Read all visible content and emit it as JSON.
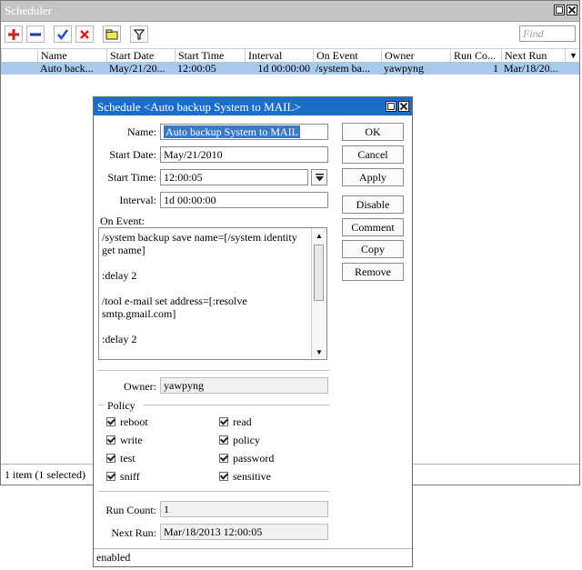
{
  "scheduler": {
    "title": "Scheduler",
    "find_placeholder": "Find",
    "columns": [
      "Name",
      "Start Date",
      "Start Time",
      "Interval",
      "On Event",
      "Owner",
      "Run Co...",
      "Next Run"
    ],
    "rows": [
      [
        "Auto back...",
        "May/21/20...",
        "12:00:05",
        "1d 00:00:00",
        "/system ba...",
        "yawpyng",
        "1",
        "Mar/18/20..."
      ]
    ],
    "status": "1 item (1 selected)",
    "icons": [
      "add-icon",
      "remove-icon",
      "enable-icon",
      "disable-icon",
      "comment-icon",
      "filter-icon"
    ]
  },
  "dialog": {
    "title": "Schedule <Auto backup System to MAIL>",
    "name_label": "Name:",
    "name_value": "Auto backup System to MAIL",
    "start_date_label": "Start Date:",
    "start_date_value": "May/21/2010",
    "start_time_label": "Start Time:",
    "start_time_value": "12:00:05",
    "interval_label": "Interval:",
    "interval_value": "1d 00:00:00",
    "on_event_label": "On Event:",
    "on_event_value": "/system backup save name=[/system identity get name]\n\n:delay 2\n\n/tool e-mail set address=[:resolve smtp.gmail.com]\n\n:delay 2",
    "owner_label": "Owner:",
    "owner_value": "yawpyng",
    "policy_label": "Policy",
    "policies": [
      {
        "label": "reboot",
        "checked": true
      },
      {
        "label": "read",
        "checked": true
      },
      {
        "label": "write",
        "checked": true
      },
      {
        "label": "policy",
        "checked": true
      },
      {
        "label": "test",
        "checked": true
      },
      {
        "label": "password",
        "checked": true
      },
      {
        "label": "sniff",
        "checked": true
      },
      {
        "label": "sensitive",
        "checked": true
      }
    ],
    "run_count_label": "Run Count:",
    "run_count_value": "1",
    "next_run_label": "Next Run:",
    "next_run_value": "Mar/18/2013 12:00:05",
    "status": "enabled",
    "buttons": {
      "ok": "OK",
      "cancel": "Cancel",
      "apply": "Apply",
      "disable": "Disable",
      "comment": "Comment",
      "copy": "Copy",
      "remove": "Remove"
    }
  },
  "colors": {
    "dialog_title_bg": "#1a6ec7",
    "selection_bg": "#a8c8ec",
    "add_icon": "#d42020",
    "enable_icon": "#1e50b4"
  }
}
